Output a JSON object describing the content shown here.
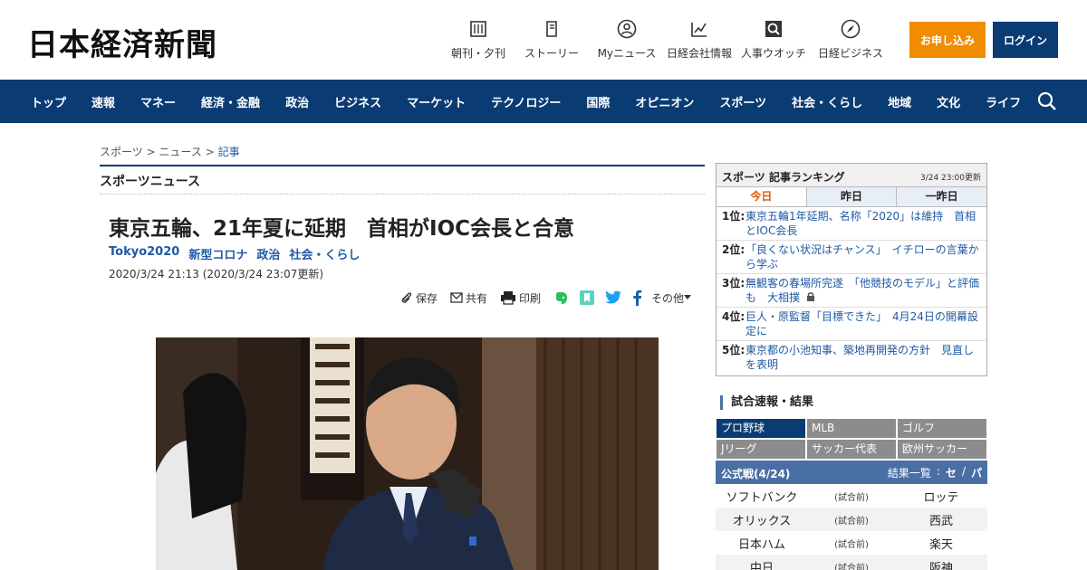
{
  "header": {
    "logo": "日本経済新聞",
    "nav": [
      {
        "label": "朝刊・夕刊",
        "icon": "newspaper-icon"
      },
      {
        "label": "ストーリー",
        "icon": "book-icon"
      },
      {
        "label": "Myニュース",
        "icon": "user-icon"
      },
      {
        "label": "日経会社情報",
        "icon": "chart-icon"
      },
      {
        "label": "人事ウオッチ",
        "icon": "search-person-icon"
      },
      {
        "label": "日経ビジネス",
        "icon": "compass-icon"
      }
    ],
    "apply_label": "お申し込み",
    "login_label": "ログイン"
  },
  "navbar": {
    "items": [
      "トップ",
      "速報",
      "マネー",
      "経済・金融",
      "政治",
      "ビジネス",
      "マーケット",
      "テクノロジー",
      "国際",
      "オピニオン",
      "スポーツ",
      "社会・くらし",
      "地域",
      "文化",
      "ライフ"
    ]
  },
  "breadcrumb": {
    "items": [
      "スポーツ",
      "ニュース",
      "記事"
    ],
    "separator": ">"
  },
  "section": {
    "title": "スポーツニュース"
  },
  "article": {
    "headline": "東京五輪、21年夏に延期　首相がIOC会長と合意",
    "tags": [
      "Tokyo2020",
      "新型コロナ",
      "政治",
      "社会・くらし"
    ],
    "dateline": "2020/3/24 21:13 (2020/3/24 23:07更新)",
    "share": {
      "save": "保存",
      "share": "共有",
      "print": "印刷",
      "more": "その他"
    }
  },
  "ranking": {
    "title": "スポーツ 記事ランキング",
    "stamp": "3/24 23:00更新",
    "tabs": [
      "今日",
      "昨日",
      "一昨日"
    ],
    "items": [
      {
        "rank": "1位:",
        "text": "東京五輪1年延期、名称「2020」は維持　首相とIOC会長"
      },
      {
        "rank": "2位:",
        "text": "「良くない状況はチャンス」　イチローの言葉から学ぶ"
      },
      {
        "rank": "3位:",
        "text": "無観客の春場所完遂　「他競技のモデル」と評価も　大相撲"
      },
      {
        "rank": "4位:",
        "text": "巨人・原監督「目標できた」　4月24日の開幕設定に"
      },
      {
        "rank": "5位:",
        "text": "東京都の小池知事、築地再開発の方針　見直しを表明"
      }
    ]
  },
  "games": {
    "title": "試合速報・結果",
    "categories": [
      "プロ野球",
      "MLB",
      "ゴルフ",
      "Jリーグ",
      "サッカー代表",
      "欧州サッカー"
    ],
    "schedule_title": "公式戦(4/24)",
    "results_label": "結果一覧",
    "colon": ":",
    "league_se": "セ",
    "slash": "/",
    "league_pa": "パ",
    "rows": [
      {
        "home": "ソフトバンク",
        "status": "(試合前)",
        "away": "ロッテ"
      },
      {
        "home": "オリックス",
        "status": "(試合前)",
        "away": "西武"
      },
      {
        "home": "日本ハム",
        "status": "(試合前)",
        "away": "楽天"
      },
      {
        "home": "中日",
        "status": "(試合前)",
        "away": "阪神"
      }
    ]
  },
  "colors": {
    "brand_navy": "#0b3b73",
    "apply_orange": "#f18c00",
    "link_blue": "#1f5aa6"
  }
}
